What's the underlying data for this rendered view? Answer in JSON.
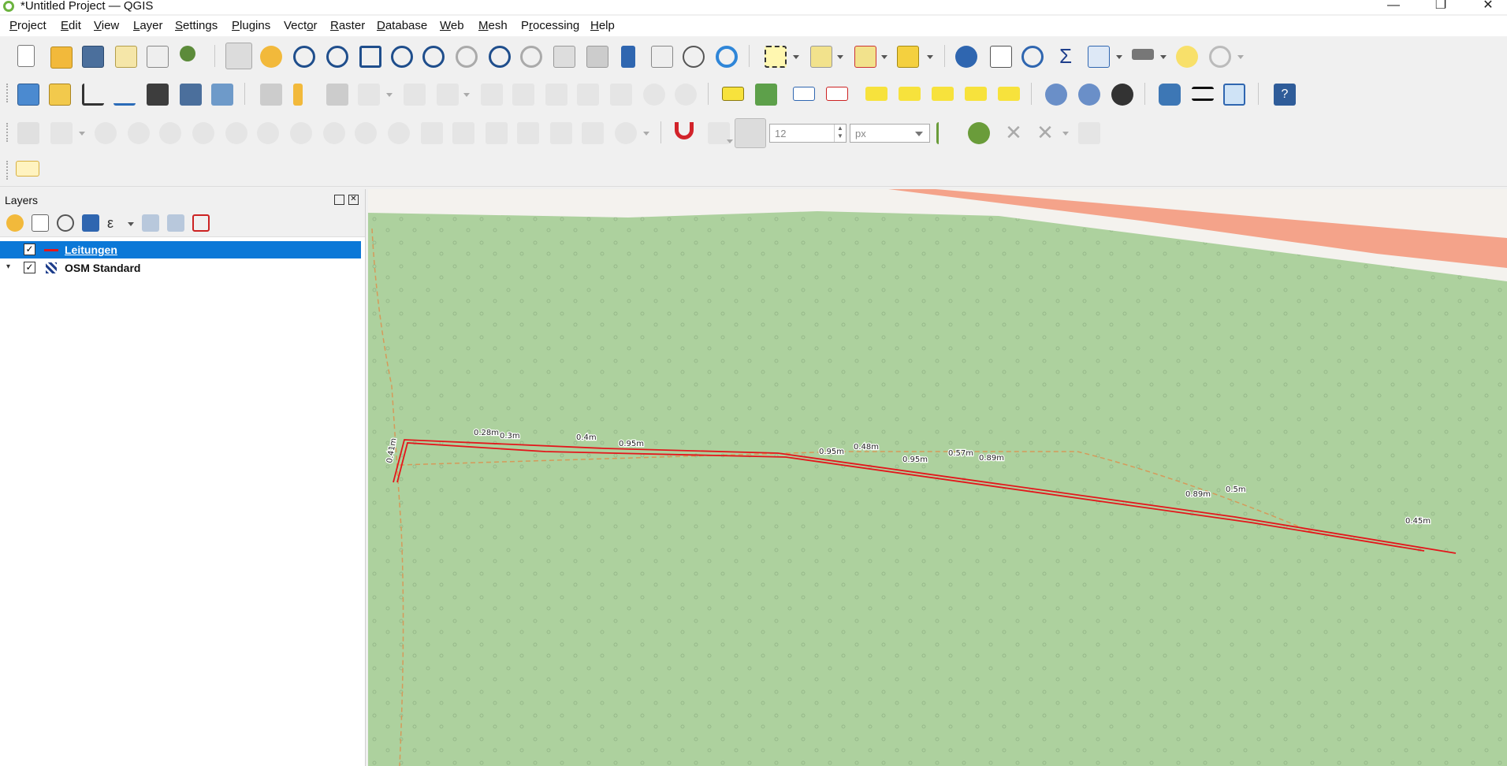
{
  "window": {
    "title": "*Untitled Project — QGIS",
    "controls": [
      "—",
      "❐",
      "✕"
    ]
  },
  "menubar": {
    "items": [
      {
        "label": "Project",
        "accel": "P",
        "rest": "roject"
      },
      {
        "label": "Edit",
        "accel": "E",
        "rest": "dit"
      },
      {
        "label": "View",
        "accel": "V",
        "rest": "iew"
      },
      {
        "label": "Layer",
        "accel": "L",
        "rest": "ayer"
      },
      {
        "label": "Settings",
        "accel": "S",
        "rest": "ettings"
      },
      {
        "label": "Plugins",
        "accel": "P",
        "rest": "lugins"
      },
      {
        "label": "Vector",
        "accel": "o",
        "pre": "Vect",
        "rest": "r"
      },
      {
        "label": "Raster",
        "accel": "R",
        "rest": "aster"
      },
      {
        "label": "Database",
        "accel": "D",
        "rest": "atabase"
      },
      {
        "label": "Web",
        "accel": "W",
        "rest": "eb"
      },
      {
        "label": "Mesh",
        "accel": "M",
        "rest": "esh"
      },
      {
        "label": "Processing",
        "accel": "r",
        "pre": "P",
        "rest": "ocessing"
      },
      {
        "label": "Help",
        "accel": "H",
        "rest": "elp"
      }
    ]
  },
  "snapping": {
    "tolerance_value": "12",
    "units_value": "px"
  },
  "layers_panel": {
    "title": "Layers",
    "layers": [
      {
        "name": "Leitungen",
        "checked": "✓",
        "selected": true,
        "legend_color": "#e3161b"
      },
      {
        "name": "OSM Standard",
        "checked": "✓",
        "selected": false,
        "expander": "▾"
      }
    ]
  },
  "map": {
    "colors": {
      "forest": "#add19e",
      "road_band": "#f4f2ee",
      "road": "#f4a38a",
      "leitung": "#e3161b",
      "track": "#d59a5a"
    },
    "labels": [
      "0.41m",
      "0.28m",
      "0.3m",
      "0.4m",
      "0.95m",
      "0.95m",
      "0.48m",
      "0.95m",
      "0.57m",
      "0.89m",
      "0.89m",
      "0.5m",
      "0.45m"
    ]
  }
}
